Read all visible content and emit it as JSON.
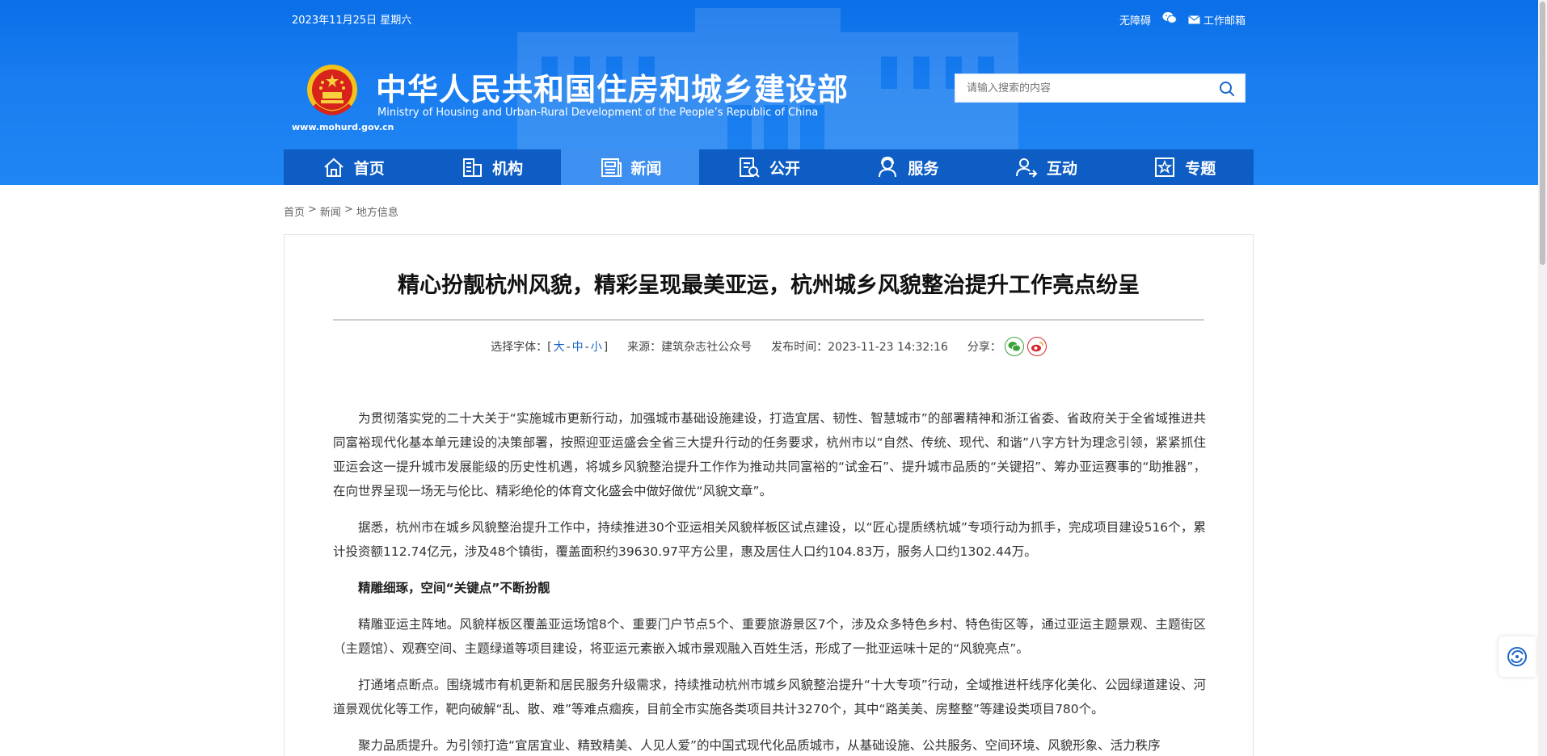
{
  "topbar": {
    "date": "2023年11月25日 星期六",
    "accessibility": "无障碍",
    "mail": "工作邮箱"
  },
  "logo": {
    "title": "中华人民共和国住房和城乡建设部",
    "subtitle": "Ministry of Housing and Urban-Rural Development of the People’s Republic of China",
    "domain": "www.mohurd.gov.cn"
  },
  "search": {
    "placeholder": "请输入搜索的内容"
  },
  "nav": {
    "items": [
      {
        "label": "首页",
        "icon": "home-icon"
      },
      {
        "label": "机构",
        "icon": "building-icon"
      },
      {
        "label": "新闻",
        "icon": "newspaper-icon"
      },
      {
        "label": "公开",
        "icon": "document-icon"
      },
      {
        "label": "服务",
        "icon": "service-icon"
      },
      {
        "label": "互动",
        "icon": "interaction-icon"
      },
      {
        "label": "专题",
        "icon": "star-icon"
      }
    ],
    "active": "新闻"
  },
  "breadcrumb": {
    "home": "首页",
    "sep": ">",
    "news": "新闻",
    "current": "地方信息"
  },
  "article": {
    "title": "精心扮靓杭州风貌，精彩呈现最美亚运，杭州城乡风貌整治提升工作亮点纷呈",
    "font_label": "选择字体：[",
    "font_big": "大",
    "font_mid": "中",
    "font_small": "小",
    "font_close": "]",
    "dash": "-",
    "source": "来源：建筑杂志社公众号",
    "time": "发布时间：2023-11-23 14:32:16",
    "share": "分享：",
    "paragraphs": [
      "为贯彻落实党的二十大关于“实施城市更新行动，加强城市基础设施建设，打造宜居、韧性、智慧城市”的部署精神和浙江省委、省政府关于全省域推进共同富裕现代化基本单元建设的决策部署，按照迎亚运盛会全省三大提升行动的任务要求，杭州市以“自然、传统、现代、和谐”八字方针为理念引领，紧紧抓住亚运会这一提升城市发展能级的历史性机遇，将城乡风貌整治提升工作作为推动共同富裕的“试金石”、提升城市品质的“关键招”、筹办亚运赛事的“助推器”，在向世界呈现一场无与伦比、精彩绝伦的体育文化盛会中做好做优“风貌文章”。",
      "据悉，杭州市在城乡风貌整治提升工作中，持续推进30个亚运相关风貌样板区试点建设，以“匠心提质绣杭城”专项行动为抓手，完成项目建设516个，累计投资额112.74亿元，涉及48个镇街，覆盖面积约39630.97平方公里，惠及居住人口约104.83万，服务人口约1302.44万。",
      "精雕细琢，空间“关键点”不断扮靓",
      "精雕亚运主阵地。风貌样板区覆盖亚运场馆8个、重要门户节点5个、重要旅游景区7个，涉及众多特色乡村、特色街区等，通过亚运主题景观、主题街区（主题馆）、观赛空间、主题绿道等项目建设，将亚运元素嵌入城市景观融入百姓生活，形成了一批亚运味十足的“风貌亮点”。",
      "打通堵点断点。围绕城市有机更新和居民服务升级需求，持续推动杭州市城乡风貌整治提升“十大专项”行动，全域推进杆线序化美化、公园绿道建设、河道景观优化等工作，靶向破解“乱、散、难”等难点痼疾，目前全市实施各类项目共计3270个，其中“路美美、房整整”等建设类项目780个。",
      "聚力品质提升。为引领打造“宜居宜业、精致精美、人见人爱”的中国式现代化品质城市，从基础设施、公共服务、空间环境、风貌形象、活力秩序"
    ]
  },
  "colors": {
    "header_blue": "#1a7df0",
    "nav_blue": "#0d5dc4",
    "nav_active": "#3d8ff0",
    "link_blue": "#1a66c9"
  }
}
